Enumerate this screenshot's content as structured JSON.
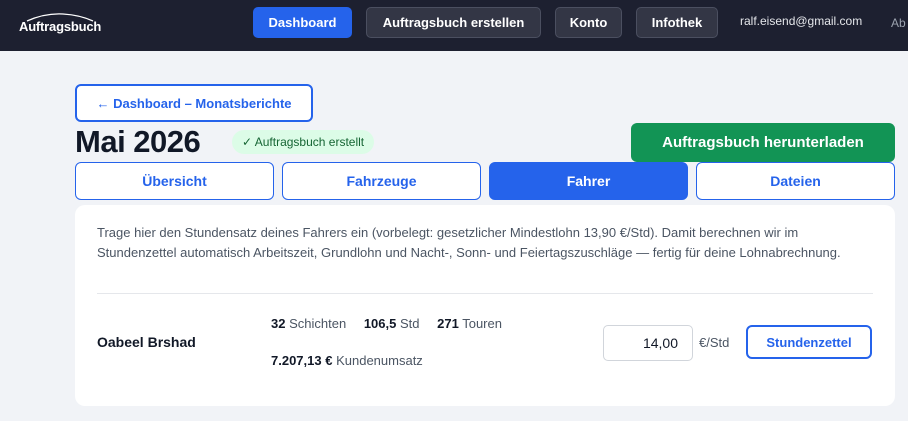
{
  "header": {
    "logo_text": "Auftragsbuch",
    "nav": {
      "dashboard": "Dashboard",
      "create": "Auftragsbuch erstellen",
      "konto": "Konto",
      "infothek": "Infothek"
    },
    "user_email": "ralf.eisend@gmail.com",
    "user_extra": "Ab"
  },
  "page": {
    "back_label": "← Dashboard – Monatsberichte",
    "title": "Mai 2026",
    "status_badge": "✓ Auftragsbuch erstellt",
    "download_label": "Auftragsbuch herunterladen",
    "tabs": [
      "Übersicht",
      "Fahrzeuge",
      "Fahrer",
      "Dateien"
    ],
    "active_tab": "Fahrer"
  },
  "card": {
    "info_text": "Trage hier den Stundensatz deines Fahrers ein (vorbelegt: gesetzlicher Mindestlohn 13,90 €/Std). Damit berechnen wir im Stundenzettel automatisch Arbeitszeit, Grundlohn und Nacht-, Sonn- und Feiertagszuschläge — fertig für deine Lohnabrechnung.",
    "driver": {
      "name": "Oabeel Brshad",
      "shifts_value": "32",
      "shifts_label": "Schichten",
      "hours_value": "106,5",
      "hours_label": "Std",
      "tours_value": "271",
      "tours_label": "Touren",
      "revenue_value": "7.207,13 €",
      "revenue_label": "Kundenumsatz",
      "rate_value": "14,00",
      "rate_unit": "€/Std",
      "timesheet_label": "Stundenzettel"
    }
  },
  "colors": {
    "topbar": "#1d2030",
    "accent": "#2563eb",
    "download": "#129455",
    "badge_bg": "#dcfce7"
  }
}
